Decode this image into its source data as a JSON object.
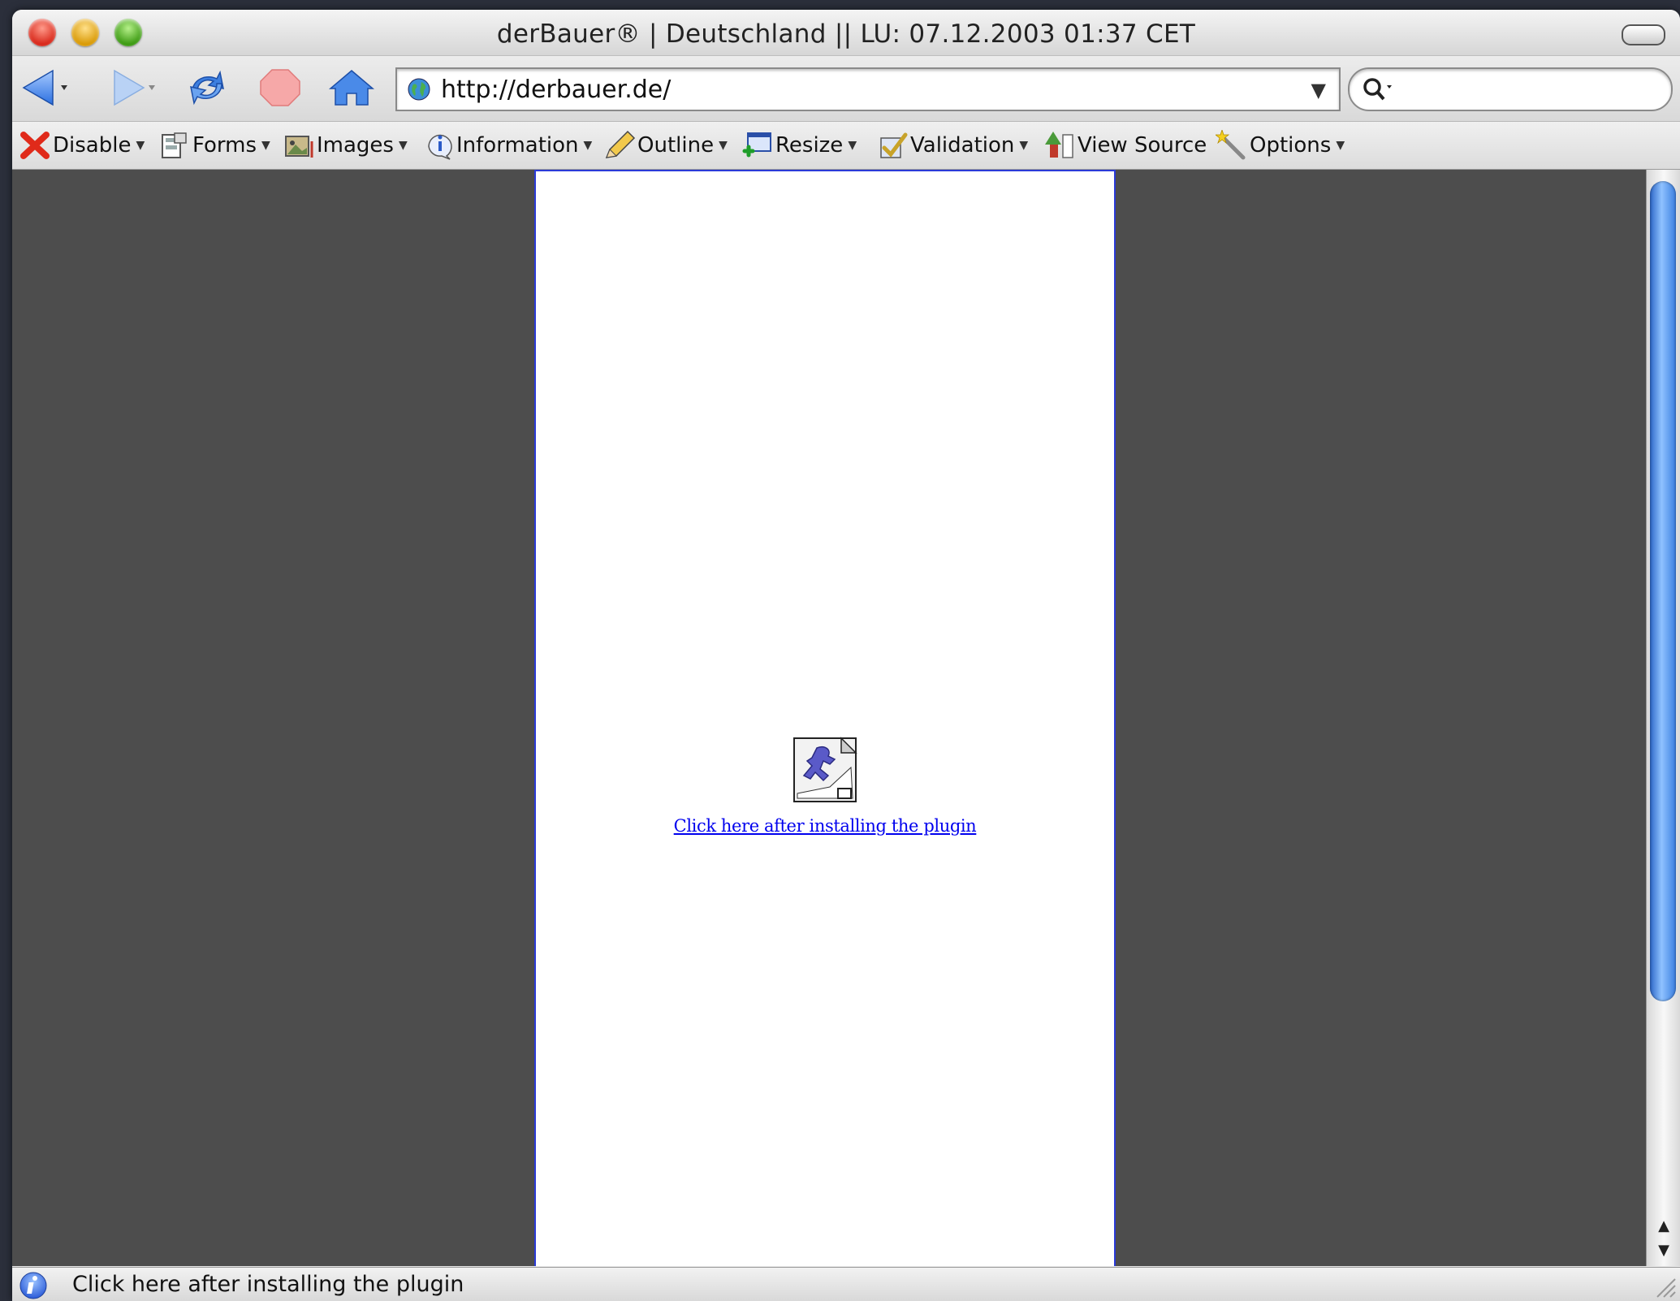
{
  "window": {
    "title": "derBauer® | Deutschland || LU: 07.12.2003 01:37 CET"
  },
  "navigation": {
    "url": "http://derbauer.de/",
    "search_value": ""
  },
  "dev_toolbar": {
    "items": [
      {
        "label": "Disable",
        "icon": "red-x-icon"
      },
      {
        "label": "Forms",
        "icon": "forms-icon"
      },
      {
        "label": "Images",
        "icon": "images-icon"
      },
      {
        "label": "Information",
        "icon": "information-icon"
      },
      {
        "label": "Outline",
        "icon": "pencil-icon"
      },
      {
        "label": "Resize",
        "icon": "resize-icon"
      },
      {
        "label": "Validation",
        "icon": "checkmark-icon"
      },
      {
        "label": "View Source",
        "icon": "view-source-icon"
      },
      {
        "label": "Options",
        "icon": "wand-icon"
      }
    ]
  },
  "page": {
    "plugin_link": "Click here after installing the plugin",
    "link_color": "#0000ee",
    "border_color": "#2b3bd8"
  },
  "status": {
    "text": "Click here after installing the plugin"
  }
}
